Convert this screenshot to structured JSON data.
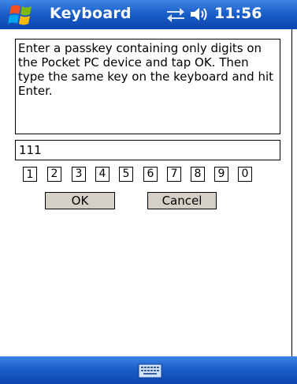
{
  "titlebar": {
    "title": "Keyboard",
    "clock": "11:56",
    "start_icon": "windows-flag-icon",
    "connectivity_icon": "connectivity-icon",
    "volume_icon": "speaker-icon"
  },
  "content": {
    "instructions": "Enter a passkey containing only digits on the Pocket PC device and tap OK. Then type the same key on the keyboard and hit Enter.",
    "passkey_value": "111",
    "digits": [
      "1",
      "2",
      "3",
      "4",
      "5",
      "6",
      "7",
      "8",
      "9",
      "0"
    ],
    "selected_digit": "1",
    "ok_label": "OK",
    "cancel_label": "Cancel"
  },
  "menubar": {
    "sip_icon": "keyboard-icon"
  },
  "colors": {
    "bar_blue": "#1b5fc9",
    "button_gray": "#d4d0c8",
    "background": "#ffffff"
  }
}
